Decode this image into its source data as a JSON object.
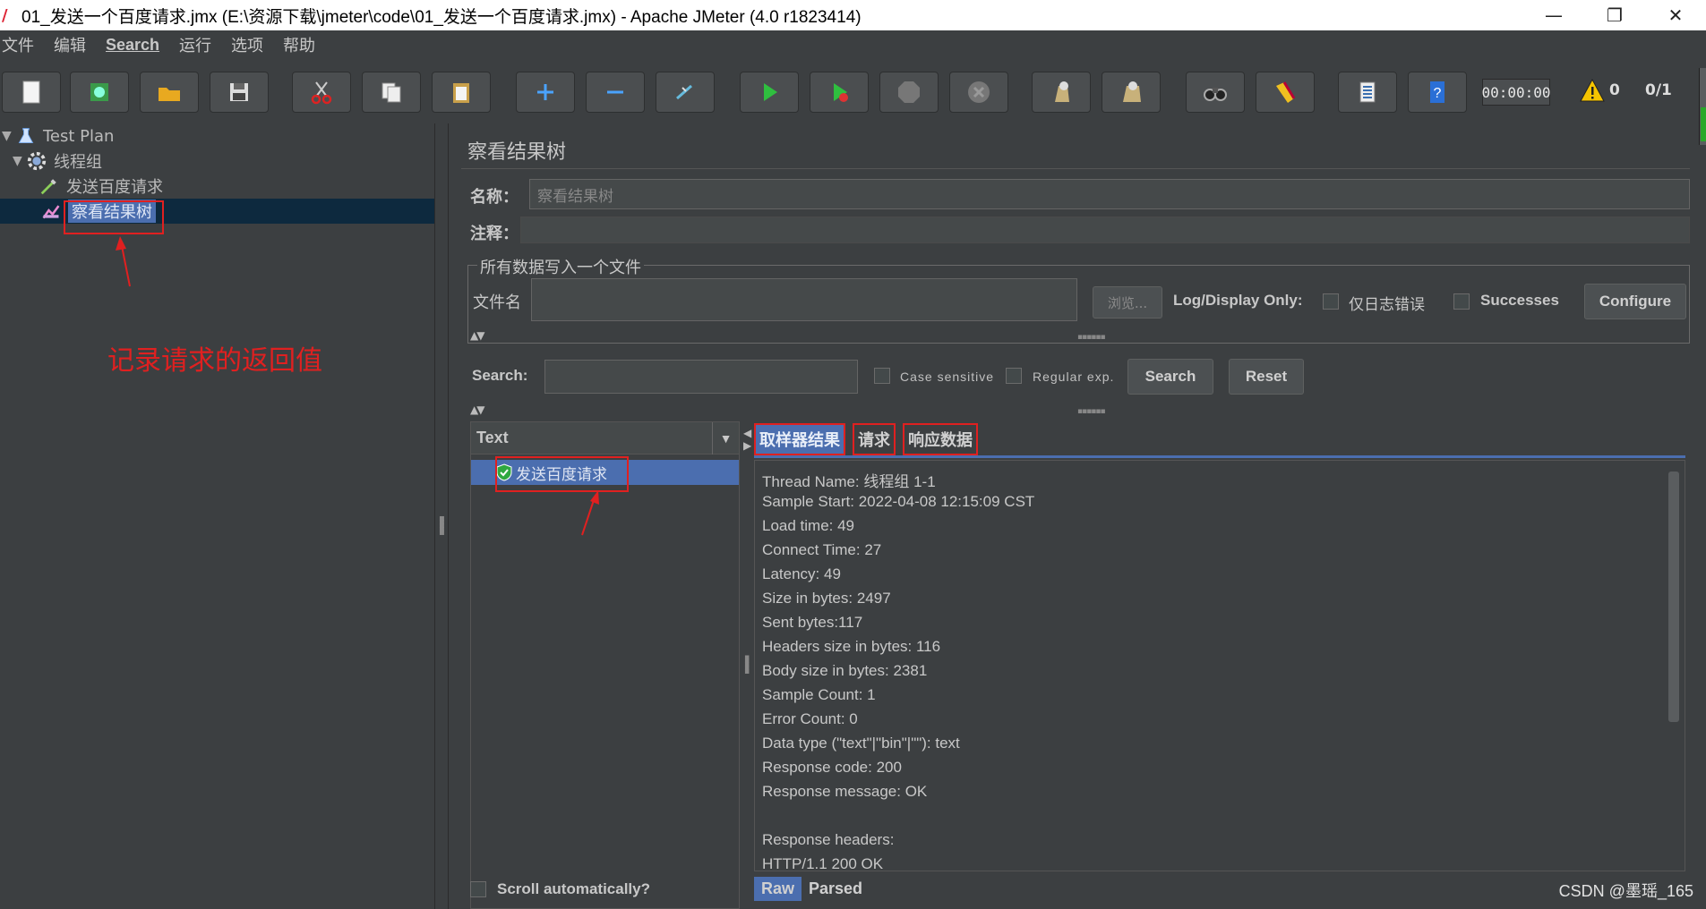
{
  "window": {
    "title": "01_发送一个百度请求.jmx (E:\\资源下载\\jmeter\\code\\01_发送一个百度请求.jmx) - Apache JMeter (4.0 r1823414)",
    "minimize": "—",
    "restore": "❐",
    "close": "✕"
  },
  "menu": [
    "文件",
    "编辑",
    "Search",
    "运行",
    "选项",
    "帮助"
  ],
  "toolbar": {
    "timer": "00:00:00",
    "warnings": "0",
    "threads": "0/1",
    "icons": [
      "new-icon",
      "templates-icon",
      "open-icon",
      "save-icon",
      "cut-icon",
      "copy-icon",
      "paste-icon",
      "expand-icon",
      "collapse-icon",
      "toggle-icon",
      "start-icon",
      "start-no-pause-icon",
      "stop-icon",
      "shutdown-icon",
      "clear-icon",
      "clear-all-icon",
      "search-icon",
      "reset-search-icon",
      "function-helper-icon",
      "help-icon"
    ]
  },
  "tree": {
    "items": [
      {
        "label": "Test Plan",
        "icon": "flask-icon"
      },
      {
        "label": "线程组",
        "icon": "gear-icon"
      },
      {
        "label": "发送百度请求",
        "icon": "pipette-icon"
      },
      {
        "label": "察看结果树",
        "icon": "chart-icon"
      }
    ]
  },
  "annotation": "记录请求的返回值",
  "panel": {
    "title": "察看结果树",
    "name_label": "名称：",
    "name_value": "察看结果树",
    "comment_label": "注释：",
    "comment_value": "",
    "file_group_title": "所有数据写入一个文件",
    "filename_label": "文件名",
    "filename_value": "",
    "browse_label": "浏览...",
    "log_display_only": "Log/Display Only:",
    "errors_only_label": "仅日志错误",
    "successes_label": "Successes",
    "configure_label": "Configure"
  },
  "search": {
    "label": "Search:",
    "value": "",
    "case_sensitive": "Case sensitive",
    "regular_exp": "Regular exp.",
    "search_button": "Search",
    "reset_button": "Reset"
  },
  "results": {
    "renderer": "Text",
    "samples": [
      {
        "label": "发送百度请求",
        "status": "success"
      }
    ],
    "scroll_auto": "Scroll automatically?",
    "tabs": [
      "取样器结果",
      "请求",
      "响应数据"
    ],
    "lines": [
      "Thread Name: 线程组 1-1",
      "Sample Start: 2022-04-08 12:15:09 CST",
      "Load time: 49",
      "Connect Time: 27",
      "Latency: 49",
      "Size in bytes: 2497",
      "Sent bytes:117",
      "Headers size in bytes: 116",
      "Body size in bytes: 2381",
      "Sample Count: 1",
      "Error Count: 0",
      "Data type (\"text\"|\"bin\"|\"\"): text",
      "Response code: 200",
      "Response message: OK",
      "",
      "Response headers:",
      "HTTP/1.1 200 OK"
    ],
    "bottom_tabs": [
      "Raw",
      "Parsed"
    ]
  },
  "watermark": "CSDN @墨瑶_165",
  "colors": {
    "accent": "#4b6eaf",
    "annotation": "#e02020",
    "background": "#3c3f41"
  }
}
